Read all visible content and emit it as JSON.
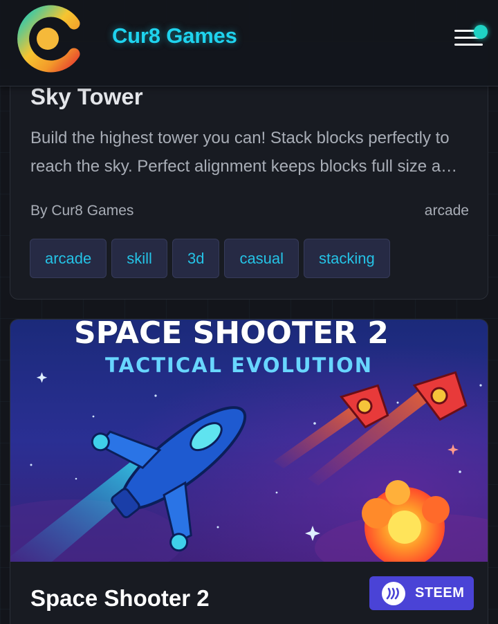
{
  "header": {
    "brand": "Cur8 Games",
    "logo_icon": "cur8-logo-icon",
    "menu_icon": "hamburger-menu-icon",
    "accent": "#1fd3ee"
  },
  "games": [
    {
      "title": "Sky Tower",
      "description": "Build the highest tower you can! Stack blocks perfectly to reach the sky. Perfect alignment keeps blocks full size and more",
      "author": "By Cur8 Games",
      "category": "arcade",
      "tags": [
        "arcade",
        "skill",
        "3d",
        "casual",
        "stacking"
      ]
    },
    {
      "title": "Space Shooter 2",
      "thumbnail": {
        "title_line1": "SPACE SHOOTER 2",
        "title_line2": "TACTICAL EVOLUTION"
      },
      "steem_label": "STEEM",
      "steem_color": "#4a43d6"
    }
  ]
}
